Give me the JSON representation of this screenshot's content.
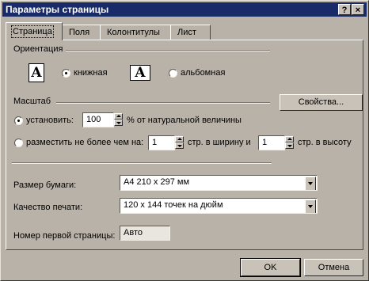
{
  "window": {
    "title": "Параметры страницы",
    "help_glyph": "?",
    "close_glyph": "×"
  },
  "tabs": [
    {
      "label": "Страница",
      "active": true
    },
    {
      "label": "Поля",
      "active": false
    },
    {
      "label": "Колонтитулы",
      "active": false
    },
    {
      "label": "Лист",
      "active": false
    }
  ],
  "orientation": {
    "group_label": "Ориентация",
    "portrait_label": "книжная",
    "landscape_label": "альбомная",
    "selected": "portrait",
    "icon_letter": "A"
  },
  "scale": {
    "group_label": "Масштаб",
    "properties_button": "Свойства...",
    "set_label": "установить:",
    "set_value": "100",
    "set_suffix": "% от натуральной величины",
    "fit_label": "разместить не более чем на:",
    "fit_wide_value": "1",
    "fit_wide_suffix": "стр. в ширину и",
    "fit_tall_value": "1",
    "fit_tall_suffix": "стр. в высоту",
    "selected": "set"
  },
  "paper": {
    "label": "Размер бумаги:",
    "value": "A4 210 x 297 мм"
  },
  "quality": {
    "label": "Качество печати:",
    "value": "120 x 144 точек на дюйм"
  },
  "first_page": {
    "label": "Номер первой страницы:",
    "value": "Авто"
  },
  "buttons": {
    "ok": "OK",
    "cancel": "Отмена"
  }
}
